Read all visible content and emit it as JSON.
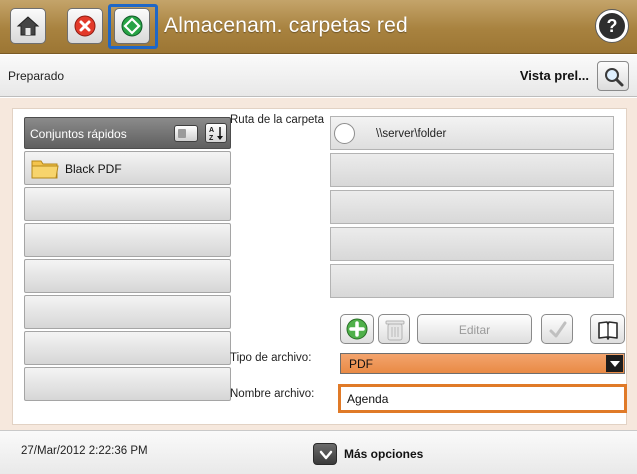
{
  "title_bar": {
    "title": "Almacenam. carpetas red",
    "home_icon": "home-icon",
    "stop_icon": "stop-icon",
    "start_icon": "start-icon",
    "help_icon": "help-icon",
    "accent_color": "#a8823f"
  },
  "status_bar": {
    "status": "Preparado",
    "preview_label": "Vista prel..."
  },
  "quick_sets": {
    "title": "Conjuntos rápidos",
    "items": [
      "Black PDF",
      "",
      "",
      "",
      "",
      "",
      ""
    ]
  },
  "folder_path": {
    "label": "Ruta de la carpeta",
    "rows": [
      "\\\\server\\folder",
      "",
      "",
      "",
      ""
    ]
  },
  "actions": {
    "edit_label": "Editar"
  },
  "file_type": {
    "label": "Tipo de archivo:",
    "value": "PDF",
    "color": "#ec9152"
  },
  "file_name": {
    "label": "Nombre archivo:",
    "value": "Agenda",
    "border_color": "#e07a28"
  },
  "footer": {
    "datetime": "27/Mar/2012 2:22:36 PM",
    "more_options": "Más opciones"
  }
}
